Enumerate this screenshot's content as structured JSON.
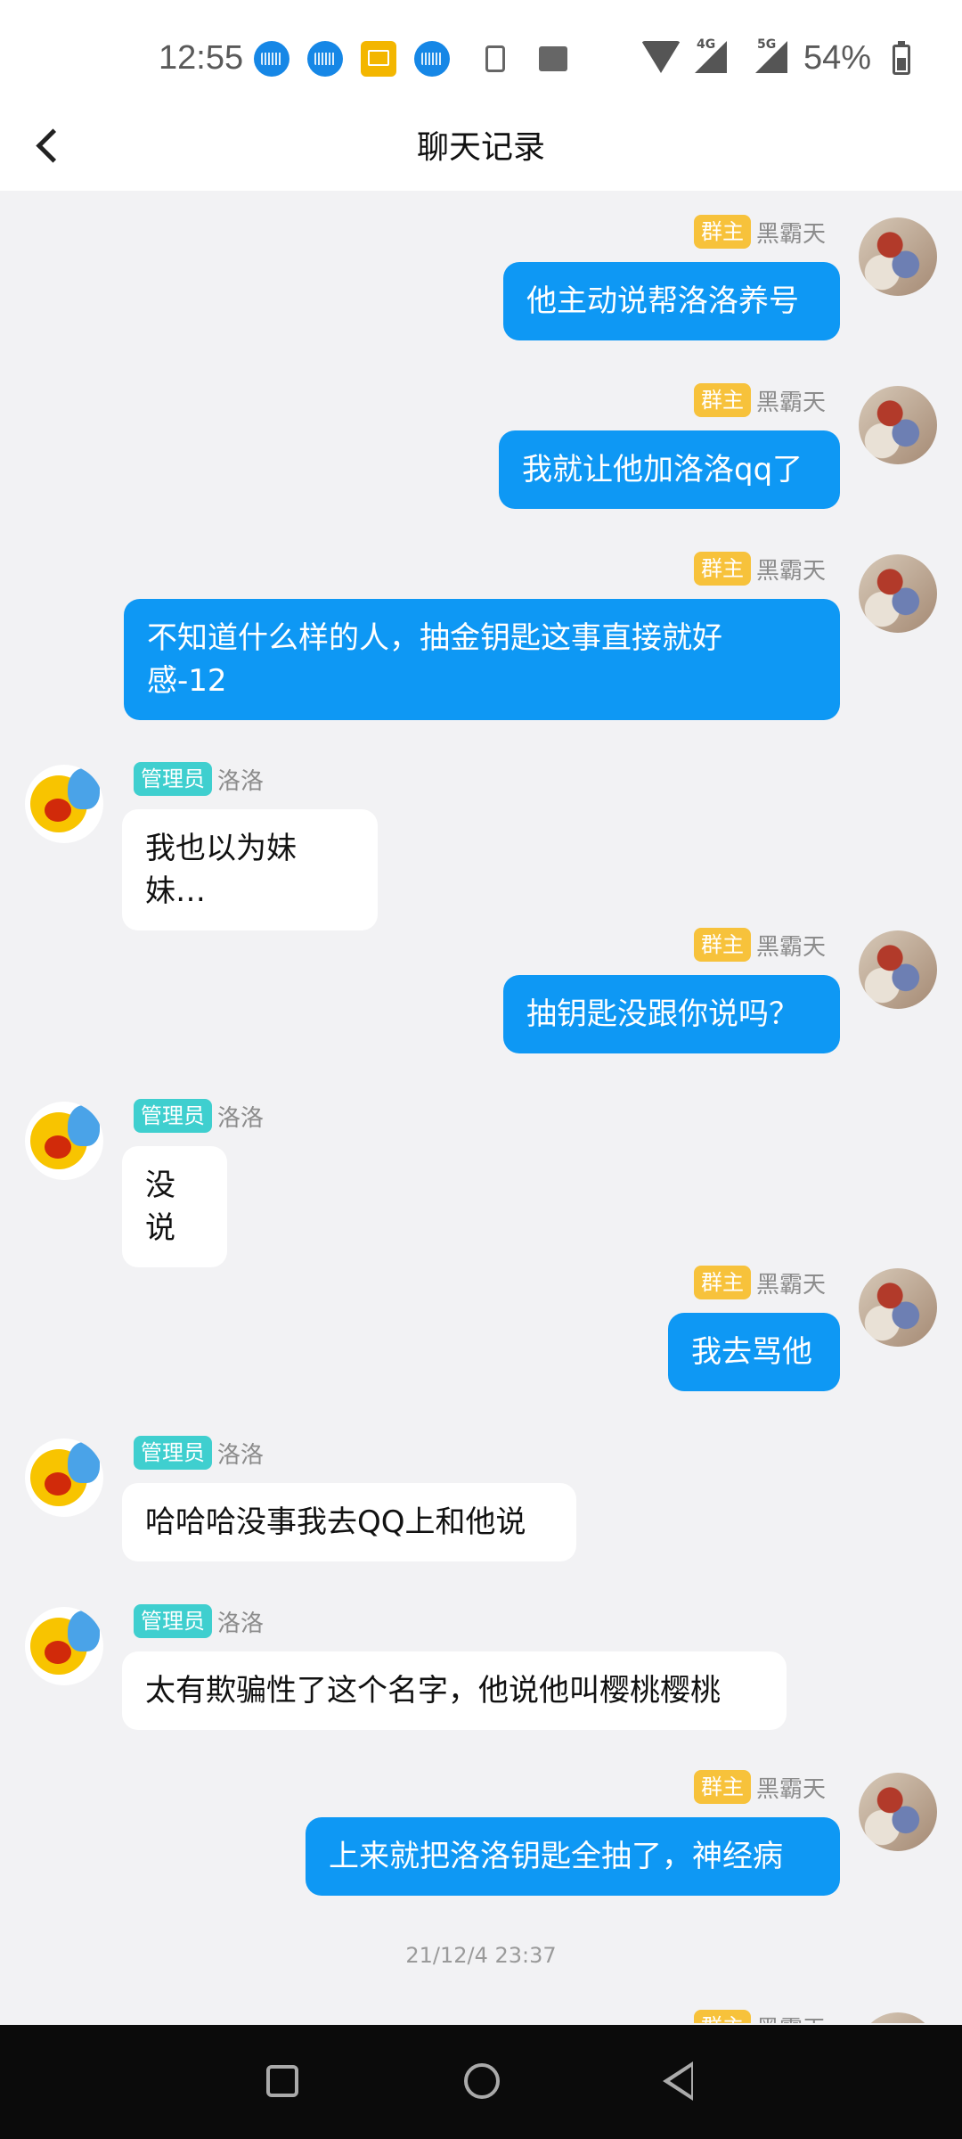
{
  "status_bar": {
    "time": "12:55",
    "battery": "54%",
    "network_tags": [
      "4G",
      "5G"
    ],
    "icons": [
      "keyboard-notification-icon",
      "keyboard-notification-icon",
      "mail-icon",
      "keyboard-notification-icon",
      "download-icon",
      "image-icon",
      "wifi-icon",
      "signal-icon",
      "signal-icon",
      "battery-icon"
    ]
  },
  "header": {
    "title": "聊天记录",
    "back_icon": "chevron-left-icon"
  },
  "messages": [
    {
      "role": "群主",
      "name": "黑霸天",
      "text": "他主动说帮洛洛养号",
      "direction": "out"
    },
    {
      "role": "群主",
      "name": "黑霸天",
      "text": "我就让他加洛洛qq了",
      "direction": "out"
    },
    {
      "role": "群主",
      "name": "黑霸天",
      "text": "不知道什么样的人，抽金钥匙这事直接就好\n感-12",
      "direction": "out"
    },
    {
      "role": "管理员",
      "name": "洛洛",
      "text": "我也以为妹妹…",
      "direction": "in"
    },
    {
      "role": "群主",
      "name": "黑霸天",
      "text": "抽钥匙没跟你说吗？",
      "direction": "out"
    },
    {
      "role": "管理员",
      "name": "洛洛",
      "text": "没说",
      "direction": "in"
    },
    {
      "role": "群主",
      "name": "黑霸天",
      "text": "我去骂他",
      "direction": "out"
    },
    {
      "role": "管理员",
      "name": "洛洛",
      "text": "哈哈哈没事我去QQ上和他说",
      "direction": "in"
    },
    {
      "role": "管理员",
      "name": "洛洛",
      "text": "太有欺骗性了这个名字，他说他叫樱桃樱桃",
      "direction": "in"
    },
    {
      "role": "群主",
      "name": "黑霸天",
      "text": "上来就把洛洛钥匙全抽了，神经病",
      "direction": "out"
    }
  ],
  "timestamp": "21/12/4 23:37",
  "partial_message": {
    "role": "群主",
    "name": "黑霸天"
  },
  "colors": {
    "outgoing_bubble": "#0e98f4",
    "incoming_bubble": "#ffffff",
    "owner_badge": "#f7c23b",
    "admin_badge": "#3fcfcf",
    "chat_background": "#f2f2f4"
  },
  "nav_bar": {
    "icons": [
      "recent-apps-icon",
      "home-icon",
      "back-icon"
    ]
  }
}
